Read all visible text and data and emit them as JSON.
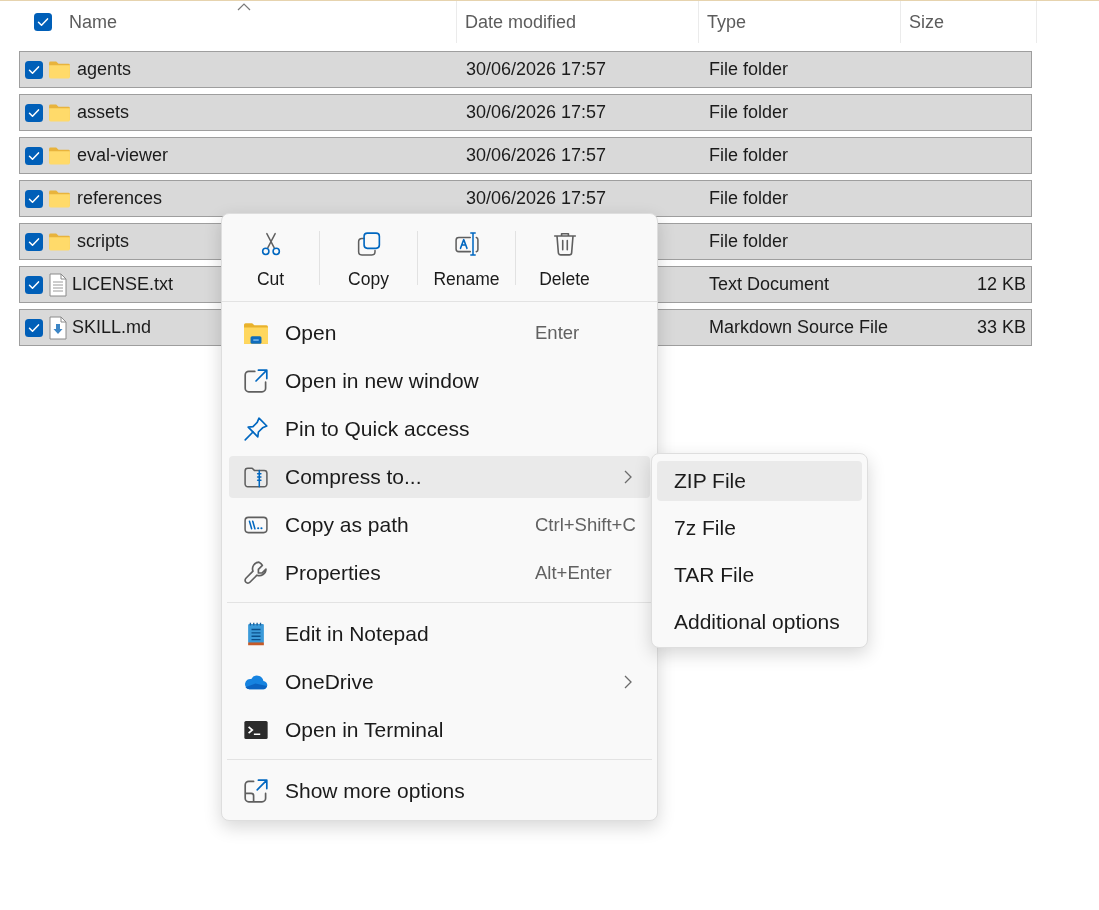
{
  "header": {
    "select_all": {
      "checked": true
    },
    "columns": [
      {
        "label": "Name",
        "sorted": true
      },
      {
        "label": "Date modified",
        "sorted": false
      },
      {
        "label": "Type",
        "sorted": false
      },
      {
        "label": "Size",
        "sorted": false
      }
    ]
  },
  "files": [
    {
      "kind": "folder",
      "name": "agents",
      "date_modified": "30/06/2026 17:57",
      "type": "File folder",
      "selected": true
    },
    {
      "kind": "folder",
      "name": "assets",
      "date_modified": "30/06/2026 17:57",
      "type": "File folder",
      "selected": true
    },
    {
      "kind": "folder",
      "name": "eval-viewer",
      "date_modified": "30/06/2026 17:57",
      "type": "File folder",
      "selected": true
    },
    {
      "kind": "folder",
      "name": "references",
      "date_modified": "30/06/2026 17:57",
      "type": "File folder",
      "selected": true
    },
    {
      "kind": "folder",
      "name": "scripts",
      "type": "File folder",
      "selected": true
    },
    {
      "kind": "text",
      "name": "LICENSE.txt",
      "type": "Text Document",
      "size": "12 KB",
      "selected": true
    },
    {
      "kind": "markdown",
      "name": "SKILL.md",
      "type": "Markdown Source File",
      "size": "33 KB",
      "selected": true
    }
  ],
  "context_menu": {
    "toolbar": [
      {
        "label": "Cut"
      },
      {
        "label": "Copy"
      },
      {
        "label": "Rename"
      },
      {
        "label": "Delete"
      }
    ],
    "groups": [
      {
        "items": [
          {
            "label": "Open",
            "shortcut": "Enter",
            "has_submenu": false,
            "selected": false
          },
          {
            "label": "Open in new window",
            "has_submenu": false,
            "selected": false
          },
          {
            "label": "Pin to Quick access",
            "has_submenu": false,
            "selected": false
          },
          {
            "label": "Compress to...",
            "has_submenu": true,
            "selected": true,
            "submenu": {
              "items": [
                {
                  "label": "ZIP File",
                  "selected": true
                },
                {
                  "label": "7z File",
                  "selected": false
                },
                {
                  "label": "TAR File",
                  "selected": false
                },
                {
                  "label": "Additional options",
                  "selected": false
                }
              ]
            }
          },
          {
            "label": "Copy as path",
            "shortcut": "Ctrl+Shift+C",
            "has_submenu": false,
            "selected": false
          },
          {
            "label": "Properties",
            "shortcut": "Alt+Enter",
            "has_submenu": false,
            "selected": false
          }
        ]
      },
      {
        "items": [
          {
            "label": "Edit in Notepad",
            "has_submenu": false,
            "selected": false
          },
          {
            "label": "OneDrive",
            "has_submenu": true,
            "selected": false
          },
          {
            "label": "Open in Terminal",
            "has_submenu": false,
            "selected": false
          }
        ]
      },
      {
        "items": [
          {
            "label": "Show more options",
            "has_submenu": false,
            "selected": false
          }
        ]
      }
    ]
  }
}
